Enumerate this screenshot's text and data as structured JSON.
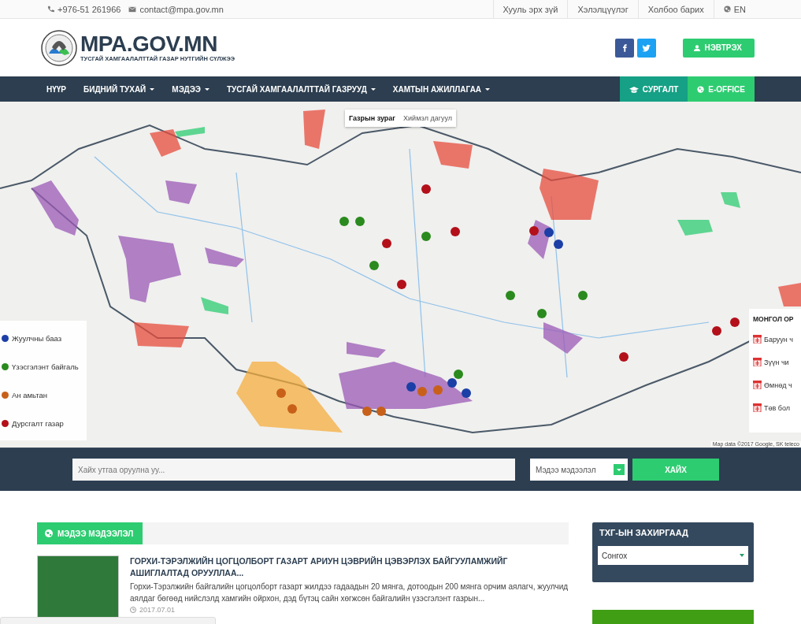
{
  "top_bar": {
    "phone": "+976-51 261966",
    "email": "contact@mpa.gov.mn",
    "links": [
      "Хууль эрх зүй",
      "Хэлэлцүүлэг",
      "Холбоо барих"
    ],
    "language": "EN"
  },
  "header": {
    "logo_title": "MPA.GOV.MN",
    "logo_subtitle": "ТУСГАЙ ХАМГААЛАЛТТАЙ ГАЗАР НУТГИЙН СҮЛЖЭЭ",
    "login": "НЭВТРЭХ"
  },
  "nav": {
    "items": [
      {
        "label": "НҮҮР",
        "dropdown": false
      },
      {
        "label": "БИДНИЙ ТУХАЙ",
        "dropdown": true
      },
      {
        "label": "МЭДЭЭ",
        "dropdown": true
      },
      {
        "label": "ТУСГАЙ ХАМГААЛАЛТТАЙ ГАЗРУУД",
        "dropdown": true
      },
      {
        "label": "ХАМТЫН АЖИЛЛАГАА",
        "dropdown": true
      }
    ],
    "actions": [
      {
        "label": "СУРГАЛТ",
        "kind": "training"
      },
      {
        "label": "E-OFFICE",
        "kind": "office"
      }
    ]
  },
  "map": {
    "map_types": [
      {
        "label": "Газрын зураг",
        "selected": true
      },
      {
        "label": "Хиймэл дагуул",
        "selected": false
      }
    ],
    "legend": [
      {
        "label": "Жуулчны бааз",
        "color": "#1b3fa6"
      },
      {
        "label": "Үзэсгэлэнт байгаль",
        "color": "#2a8a1e"
      },
      {
        "label": "Ан амьтан",
        "color": "#c8601a"
      },
      {
        "label": "Дурсгалт газар",
        "color": "#b3101a"
      }
    ],
    "regions_title": "МОНГОЛ ОР",
    "regions": [
      "Баруун ч",
      "Зүүн чи",
      "Өмнөд ч",
      "Төв бол"
    ],
    "attribution": "Map data ©2017 Google, SK teleco"
  },
  "search": {
    "placeholder": "Хайх утгаа оруулна уу...",
    "category": "Мэдээ мэдээлэл",
    "button": "ХАЙХ"
  },
  "news": {
    "heading": "МЭДЭЭ МЭДЭЭЛЭЛ",
    "articles": [
      {
        "title": "ГОРХИ-ТЭРЭЛЖИЙН ЦОГЦОЛБОРТ ГАЗАРТ АРИУН ЦЭВРИЙН ЦЭВЭРЛЭХ БАЙГУУЛАМЖИЙГ АШИГЛАЛТАД ОРУУЛЛАА...",
        "excerpt": "Горхи-Тэрэлжийн байгалийн цогцолборт газарт жилдээ гадаадын 20 мянга, дотоодын 200 мянга орчим аялагч, жуулчид аялдаг бөгөөд нийслэлд хамгийн ойрхон, дэд бүтэц сайн хөгжсөн байгалийн үзэсгэлэнт газрын...",
        "date": "2017.07.01"
      }
    ]
  },
  "sidebar": {
    "title": "ТХГ-ЫН ЗАХИРГААД",
    "select": "Сонгох"
  }
}
